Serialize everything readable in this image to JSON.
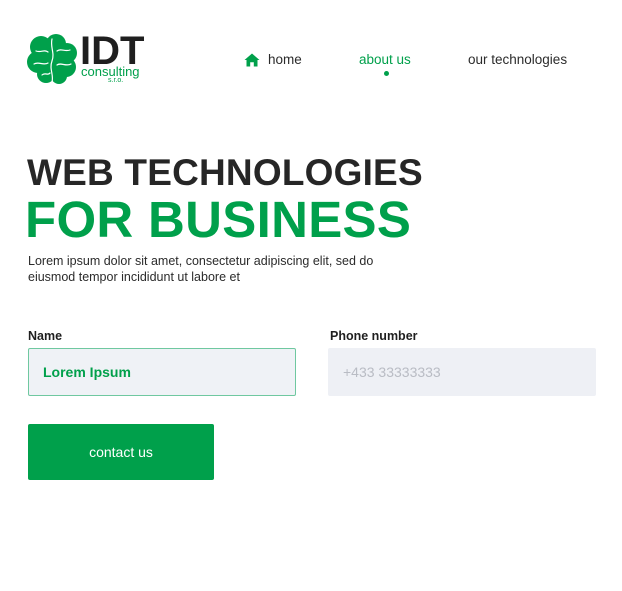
{
  "logo": {
    "name": "IDT",
    "tagline": "consulting",
    "suffix": "s.r.o."
  },
  "nav": {
    "items": [
      {
        "label": "home",
        "icon": "home-icon"
      },
      {
        "label": "about us",
        "active": true
      },
      {
        "label": "our technologies"
      }
    ]
  },
  "hero": {
    "title_line1": "WEB TECHNOLOGIES",
    "title_line2": "FOR BUSINESS",
    "description": "Lorem ipsum dolor sit amet, consectetur adipiscing elit, sed do eiusmod tempor incididunt ut labore et"
  },
  "form": {
    "name_label": "Name",
    "name_value": "Lorem Ipsum",
    "phone_label": "Phone number",
    "phone_placeholder": "+433 33333333",
    "submit_label": "contact us"
  },
  "colors": {
    "brand_green": "#00a04b",
    "heading_dark": "#262626",
    "input_bg": "#eff2f6"
  }
}
